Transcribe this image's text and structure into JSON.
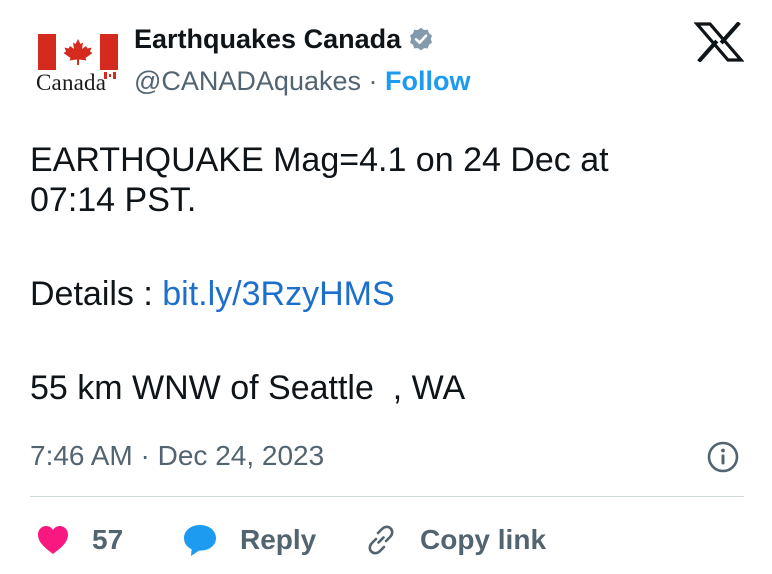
{
  "author": {
    "display_name": "Earthquakes Canada",
    "handle": "@CANADAquakes",
    "separator": " · ",
    "follow_label": "Follow",
    "avatar_wordmark": "Canada"
  },
  "tweet": {
    "line1": "EARTHQUAKE Mag=4.1 on 24 Dec at",
    "line2": "07:14 PST.",
    "details_prefix": "Details : ",
    "details_link": "bit.ly/3RzyHMS",
    "location": "55 km WNW of Seattle  , WA"
  },
  "meta": {
    "time": "7:46 AM",
    "separator": " · ",
    "date": "Dec 24, 2023"
  },
  "actions": {
    "like_count": "57",
    "reply_label": "Reply",
    "copy_label": "Copy link"
  },
  "icons": {
    "x_logo": "x-logo-icon",
    "verified": "verified-badge-icon",
    "info": "info-icon",
    "heart": "heart-icon",
    "reply": "speech-bubble-icon",
    "link": "link-icon"
  },
  "colors": {
    "text": "#0f1419",
    "muted": "#536471",
    "follow_blue": "#1d9bf0",
    "link_blue": "#1d6fcc",
    "heart_pink": "#f91880",
    "reply_blue": "#1d9bf0",
    "flag_red": "#d52b1e",
    "divider": "#cfd9de"
  }
}
